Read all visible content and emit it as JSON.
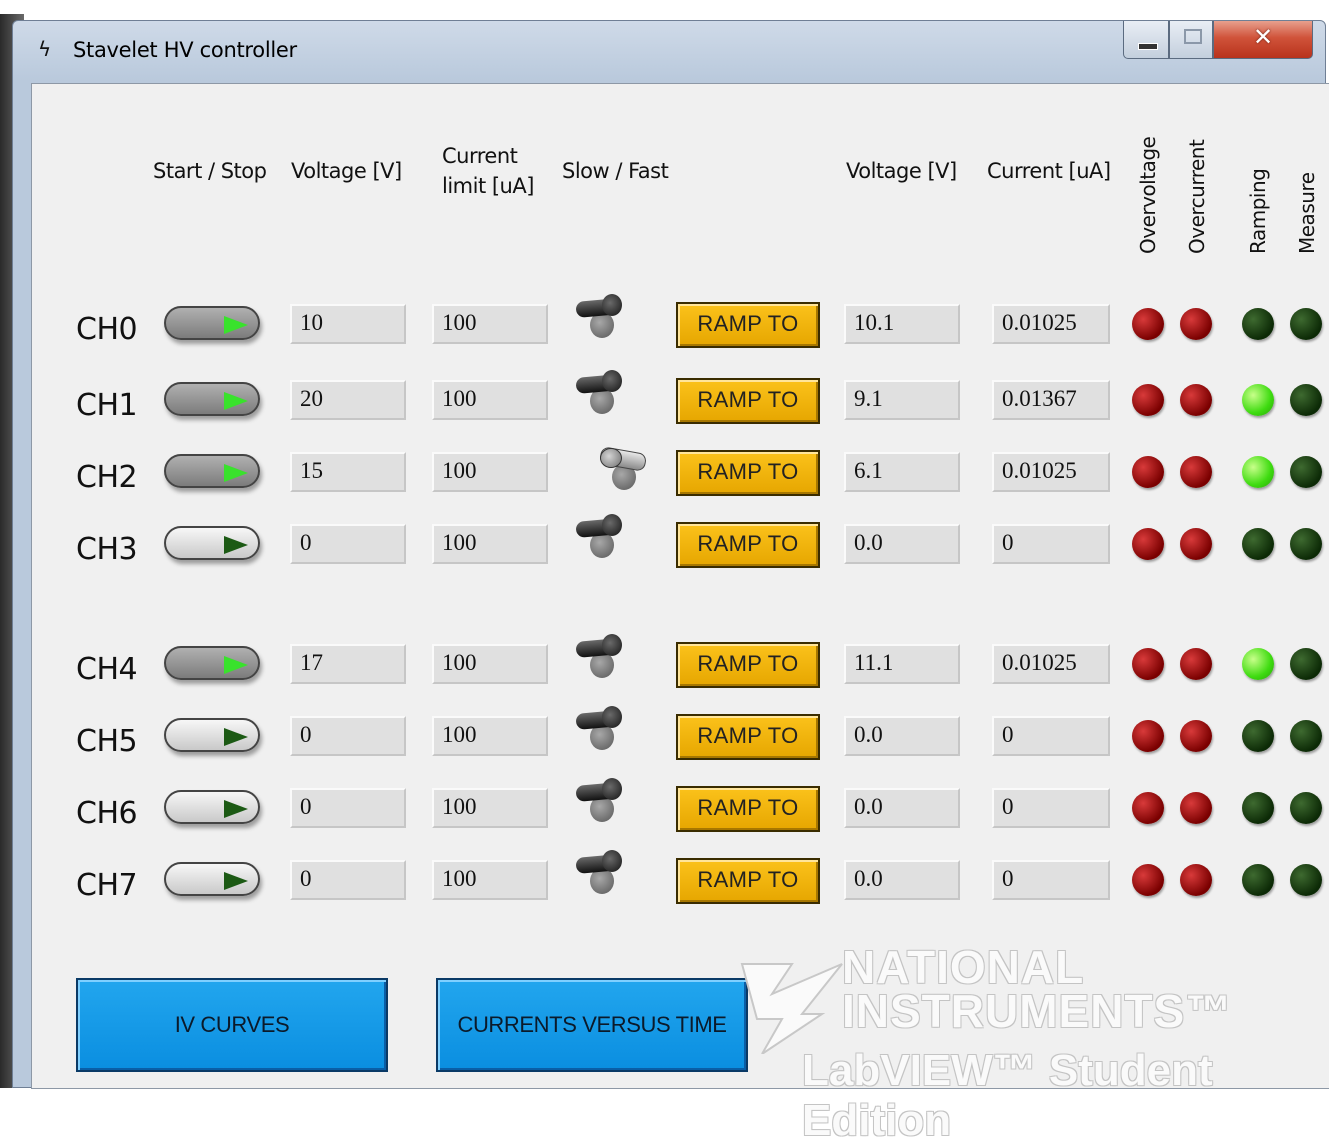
{
  "window": {
    "title": "Stavelet HV controller"
  },
  "headers": {
    "start_stop": "Start / Stop",
    "voltage_set": "Voltage [V]",
    "current_limit_line1": "Current",
    "current_limit_line2": "limit [uA]",
    "slow_fast": "Slow / Fast",
    "voltage_meas": "Voltage [V]",
    "current_meas": "Current [uA]",
    "overvoltage": "Overvoltage",
    "overcurrent": "Overcurrent",
    "ramping": "Ramping",
    "measure": "Measure"
  },
  "channels": [
    {
      "label": "CH0",
      "running": true,
      "voltage": "10",
      "current_limit": "100",
      "speed": "slow",
      "ramp_label": "RAMP TO",
      "meas_voltage": "10.1",
      "meas_current": "0.01025",
      "overvoltage": "red",
      "overcurrent": "red",
      "ramping": "off",
      "measure": "off"
    },
    {
      "label": "CH1",
      "running": true,
      "voltage": "20",
      "current_limit": "100",
      "speed": "slow",
      "ramp_label": "RAMP TO",
      "meas_voltage": "9.1",
      "meas_current": "0.01367",
      "overvoltage": "red",
      "overcurrent": "red",
      "ramping": "on",
      "measure": "off"
    },
    {
      "label": "CH2",
      "running": true,
      "voltage": "15",
      "current_limit": "100",
      "speed": "fast",
      "ramp_label": "RAMP TO",
      "meas_voltage": "6.1",
      "meas_current": "0.01025",
      "overvoltage": "red",
      "overcurrent": "red",
      "ramping": "on",
      "measure": "off"
    },
    {
      "label": "CH3",
      "running": false,
      "voltage": "0",
      "current_limit": "100",
      "speed": "slow",
      "ramp_label": "RAMP TO",
      "meas_voltage": "0.0",
      "meas_current": "0",
      "overvoltage": "red",
      "overcurrent": "red",
      "ramping": "off",
      "measure": "off"
    },
    {
      "label": "CH4",
      "running": true,
      "voltage": "17",
      "current_limit": "100",
      "speed": "slow",
      "ramp_label": "RAMP TO",
      "meas_voltage": "11.1",
      "meas_current": "0.01025",
      "overvoltage": "red",
      "overcurrent": "red",
      "ramping": "on",
      "measure": "off"
    },
    {
      "label": "CH5",
      "running": false,
      "voltage": "0",
      "current_limit": "100",
      "speed": "slow",
      "ramp_label": "RAMP TO",
      "meas_voltage": "0.0",
      "meas_current": "0",
      "overvoltage": "red",
      "overcurrent": "red",
      "ramping": "off",
      "measure": "off"
    },
    {
      "label": "CH6",
      "running": false,
      "voltage": "0",
      "current_limit": "100",
      "speed": "slow",
      "ramp_label": "RAMP TO",
      "meas_voltage": "0.0",
      "meas_current": "0",
      "overvoltage": "red",
      "overcurrent": "red",
      "ramping": "off",
      "measure": "off"
    },
    {
      "label": "CH7",
      "running": false,
      "voltage": "0",
      "current_limit": "100",
      "speed": "slow",
      "ramp_label": "RAMP TO",
      "meas_voltage": "0.0",
      "meas_current": "0",
      "overvoltage": "red",
      "overcurrent": "red",
      "ramping": "off",
      "measure": "off"
    }
  ],
  "buttons": {
    "iv_curves": "IV CURVES",
    "currents_vs_time": "CURRENTS VERSUS TIME"
  },
  "watermark": {
    "line1": "NATIONAL",
    "line2": "INSTRUMENTS™",
    "line3": "LabVIEW™ Student Edition"
  },
  "colors": {
    "ramp_button": "#f5b50a",
    "action_button": "#1199e8",
    "led_red": "#8b0000",
    "led_green_on": "#44e010",
    "led_green_off": "#123d0a"
  }
}
